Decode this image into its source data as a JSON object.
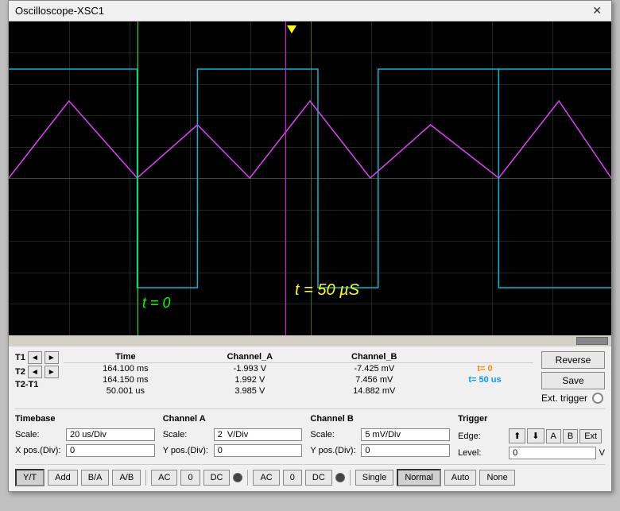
{
  "window": {
    "title": "Oscilloscope-XSC1",
    "close_label": "✕"
  },
  "screen": {
    "bg_color": "#000000",
    "grid_color": "rgba(50,80,50,0.5)"
  },
  "cursor_labels": {
    "t1_label": "t = 0",
    "t2_label": "t = 50 µS"
  },
  "measurements": {
    "headers": [
      "Time",
      "Channel_A",
      "Channel_B",
      ""
    ],
    "rows": [
      {
        "name": "T1",
        "time": "164.100 ms",
        "chA": "-1.993 V",
        "chB": "-7.425 mV",
        "tag": "t= 0"
      },
      {
        "name": "T2",
        "time": "164.150 ms",
        "chA": "1.992 V",
        "chB": "7.456 mV",
        "tag": "t= 50  us"
      },
      {
        "name": "T2-T1",
        "time": "50.001 us",
        "chA": "3.985 V",
        "chB": "14.882 mV",
        "tag": ""
      }
    ]
  },
  "buttons": {
    "reverse": "Reverse",
    "save": "Save",
    "ext_trigger": "Ext. trigger"
  },
  "timebase": {
    "title": "Timebase",
    "scale_label": "Scale:",
    "scale_value": "20 us/Div",
    "xpos_label": "X pos.(Div):",
    "xpos_value": "0"
  },
  "channel_a": {
    "title": "Channel A",
    "scale_label": "Scale:",
    "scale_value": "2  V/Div",
    "ypos_label": "Y pos.(Div):",
    "ypos_value": "0"
  },
  "channel_b": {
    "title": "Channel B",
    "scale_label": "Scale:",
    "scale_value": "5 mV/Div",
    "ypos_label": "Y pos.(Div):",
    "ypos_value": "0"
  },
  "trigger": {
    "title": "Trigger",
    "edge_label": "Edge:",
    "level_label": "Level:",
    "level_value": "0",
    "level_unit": "V",
    "edge_options": [
      "↑",
      "↓",
      "A",
      "B",
      "Ext"
    ]
  },
  "bottom_buttons": {
    "yt": "Y/T",
    "add": "Add",
    "ba": "B/A",
    "ab": "A/B",
    "ac1": "AC",
    "zero1": "0",
    "dc1": "DC",
    "ac2": "AC",
    "zero2": "0",
    "dc2": "DC",
    "single": "Single",
    "normal": "Normal",
    "auto": "Auto",
    "none": "None"
  }
}
